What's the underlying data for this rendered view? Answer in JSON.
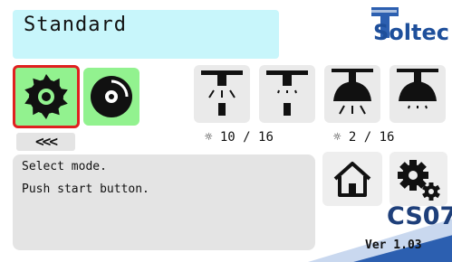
{
  "header": {
    "mode_label": "Standard"
  },
  "brand": {
    "logo_text": "Soltec",
    "model": "CS07",
    "version": "Ver 1.03"
  },
  "buttons": {
    "back_label": "<<<"
  },
  "lights": {
    "group_a_value": "10 / 16",
    "group_b_value": "2 / 16"
  },
  "messages": [
    "Select mode.",
    "Push start button."
  ],
  "colors": {
    "mode_title_bg": "#c8f6fb",
    "mode_button_bg": "#92f28f",
    "selected_border": "#e02020",
    "brand_blue": "#1e4f9b",
    "panel_gray": "#e4e4e4"
  }
}
